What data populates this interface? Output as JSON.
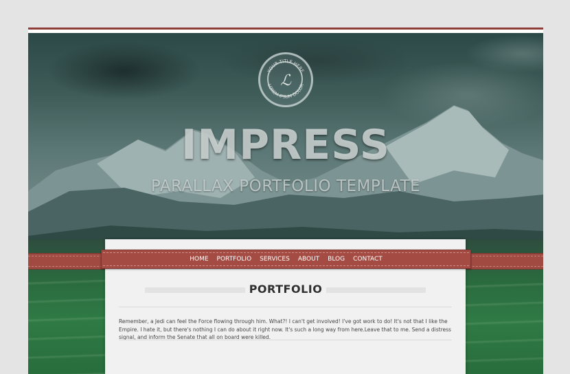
{
  "brand": {
    "emblem_ring_top": "YOUR TITLE HERE",
    "emblem_ring_bottom": "LOREM IPSUM DOLOR",
    "emblem_letter": "ℒ",
    "title": "IMPRESS",
    "subtitle": "PARALLAX PORTFOLIO TEMPLATE"
  },
  "nav": {
    "items": [
      "HOME",
      "PORTFOLIO",
      "SERVICES",
      "ABOUT",
      "BLOG",
      "CONTACT"
    ]
  },
  "section": {
    "title": "PORTFOLIO",
    "intro": "Remember, a Jedi can feel the Force flowing through him. What?! I can't get involved! I've got work to do! It's not that I like the Empire. I hate it, but there's nothing I can do about it right now. It's such a long way from here.Leave that to me. Send a distress signal, and inform the Senate that all on board were killed."
  },
  "colors": {
    "accent": "#a44c44",
    "page_bg": "#e4e4e4",
    "panel_bg": "#f1f1f1"
  }
}
